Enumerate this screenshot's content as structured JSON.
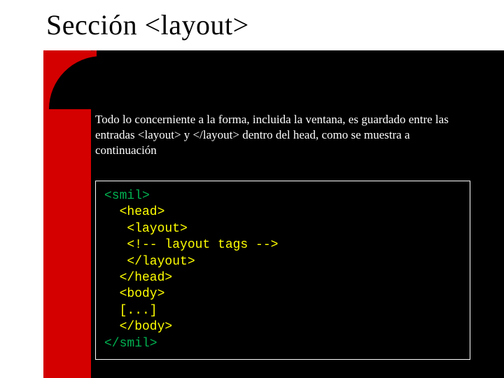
{
  "title": "Sección <layout>",
  "description": "Todo lo concerniente a la forma, incluida la ventana, es guardado entre las entradas  <layout> y </layout> dentro del head, como se muestra a continuación",
  "code": {
    "l1": "<smil>",
    "l2": "  <head>",
    "l3": "   <layout>",
    "l4": "   <!-- layout tags -->",
    "l5": "   </layout>",
    "l6": "  </head>",
    "l7": "  <body>",
    "l8": "  [...]",
    "l9": "  </body>",
    "l10": "</smil>"
  }
}
